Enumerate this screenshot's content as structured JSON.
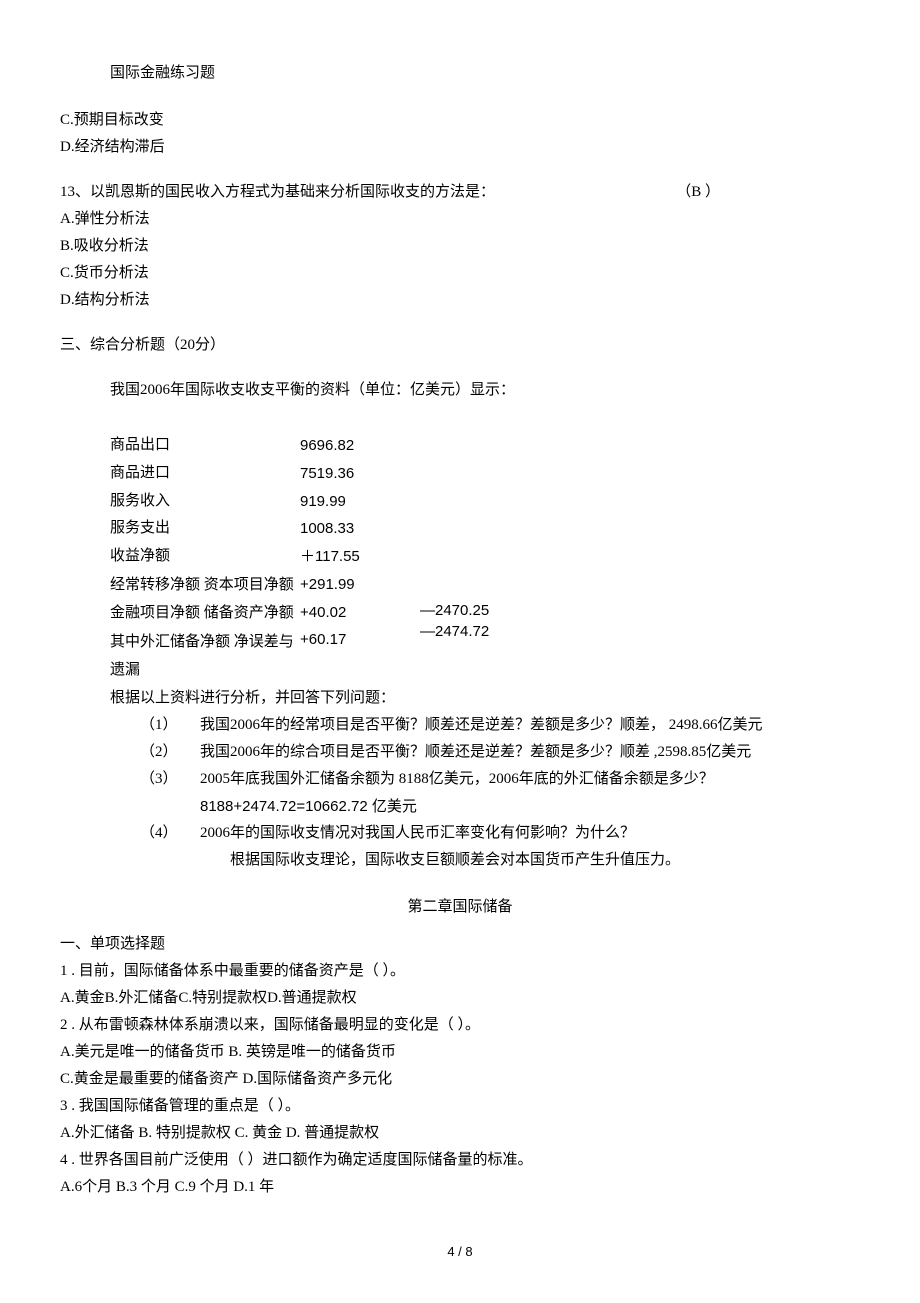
{
  "header": "国际金融练习题",
  "q12": {
    "optC": "C.预期目标改变",
    "optD": "D.经济结构滞后"
  },
  "q13": {
    "stem": "13、以凯恩斯的国民收入方程式为基础来分析国际收支的方法是：",
    "answer": "（B ）",
    "optA": "A.弹性分析法",
    "optB": "B.吸收分析法",
    "optC": "C.货币分析法",
    "optD": "D.结构分析法"
  },
  "section3": "三、综合分析题（20分）",
  "intro": "我国2006年国际收支收支平衡的资料（单位：亿美元）显示：",
  "dataLabels": {
    "l1": "商品出口",
    "l2": "商品进口",
    "l3": "服务收入",
    "l4": "服务支出",
    "l5": "收益净额",
    "l6": "经常转移净额  资本项目净额   金融项目净额   储备资产净额",
    "l7": "   其中外汇储备净额  净误差与遗漏"
  },
  "dataVals1": {
    "v1": "9696.82",
    "v2": "7519.36",
    "v3": "919.99",
    "v4": "1008.33",
    "v5": "＋117.55",
    "v6": "+291.99",
    "v7": "+40.02",
    "v8": "+60.17"
  },
  "dataVals2": {
    "v1": "—2470.25",
    "v2": "—2474.72"
  },
  "after": "根据以上资料进行分析，并回答下列问题：",
  "subq": {
    "n1": "（1）",
    "t1": "我国2006年的经常项目是否平衡？顺差还是逆差？差额是多少？顺差， 2498.66亿美元",
    "n2": "（2）",
    "t2": "我国2006年的综合项目是否平衡？顺差还是逆差？差额是多少？顺差 ,2598.85亿美元",
    "n3": "（3）",
    "t3a": "2005年底我国外汇储备余额为           8188亿美元，2006年底的外汇储备余额是多少？",
    "t3b": "8188+2474.72=10662.72 亿美元",
    "n4": "（4）",
    "t4a": "2006年的国际收支情况对我国人民币汇率变化有何影响？为什么？",
    "t4b": "根据国际收支理论，国际收支巨额顺差会对本国货币产生升值压力。"
  },
  "chapter2": "第二章国际储备",
  "ch2": {
    "sec": "一、单项选择题",
    "q1": "1 . 目前，国际储备体系中最重要的储备资产是（          ）。",
    "q1o": "A.黄金B.外汇储备C.特别提款权D.普通提款权",
    "q2": "2 . 从布雷顿森林体系崩溃以来，国际储备最明显的变化是（          ）。",
    "q2a": "A.美元是唯一的储备货币         B.     英镑是唯一的储备货币",
    "q2b": "C.黄金是最重要的储备资产      D.国际储备资产多元化",
    "q3": "3 . 我国国际储备管理的重点是（     ）。",
    "q3o": "A.外汇储备        B. 特别提款权  C. 黄金  D.                       普通提款权",
    "q4": "4 . 世界各国目前广泛使用（    ）进口额作为确定适度国际储备量的标准。",
    "q4o": "A.6个月  B.3 个月  C.9 个月  D.1 年"
  },
  "footer": "4 / 8"
}
